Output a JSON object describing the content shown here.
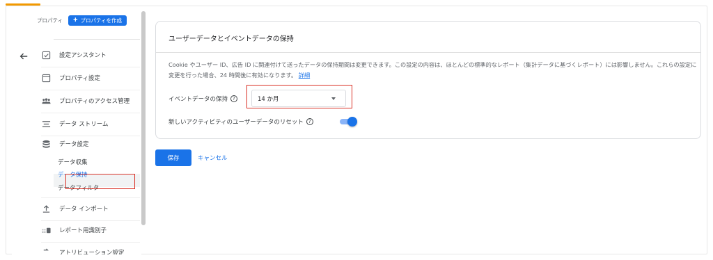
{
  "sidebar": {
    "property_label": "プロパティ",
    "create_property": "プロパティを作成",
    "items": [
      {
        "label": "設定アシスタント",
        "icon": "checkbox-icon"
      },
      {
        "label": "プロパティ設定",
        "icon": "property-settings-icon"
      },
      {
        "label": "プロパティのアクセス管理",
        "icon": "people-icon"
      },
      {
        "label": "データ ストリーム",
        "icon": "data-stream-icon"
      },
      {
        "label": "データ設定",
        "icon": "database-icon"
      },
      {
        "label": "データ インポート",
        "icon": "upload-icon"
      },
      {
        "label": "レポート用識別子",
        "icon": "identifier-icon"
      },
      {
        "label": "アトリビューション設定",
        "icon": "attribution-icon"
      }
    ],
    "sub_items": [
      {
        "label": "データ収集"
      },
      {
        "label": "データ保持"
      },
      {
        "label": "データフィルタ"
      }
    ]
  },
  "card": {
    "title": "ユーザーデータとイベントデータの保持",
    "description": "Cookie やユーザー ID、広告 ID に関連付けて送ったデータの保持期間は変更できます。この設定の内容は、ほとんどの標準的なレポート（集計データに基づくレポート）には影響しません。これらの設定に変更を行った場合、24 時間後に有効になります。",
    "details_link": "詳細",
    "event_retention_label": "イベントデータの保持",
    "event_retention_value": "14 か月",
    "reset_label": "新しいアクティビティのユーザーデータのリセット",
    "reset_enabled": true
  },
  "actions": {
    "save": "保存",
    "cancel": "キャンセル"
  },
  "colors": {
    "accent": "#1a73e8",
    "highlight": "#d93025",
    "tab_accent": "#f29900"
  }
}
